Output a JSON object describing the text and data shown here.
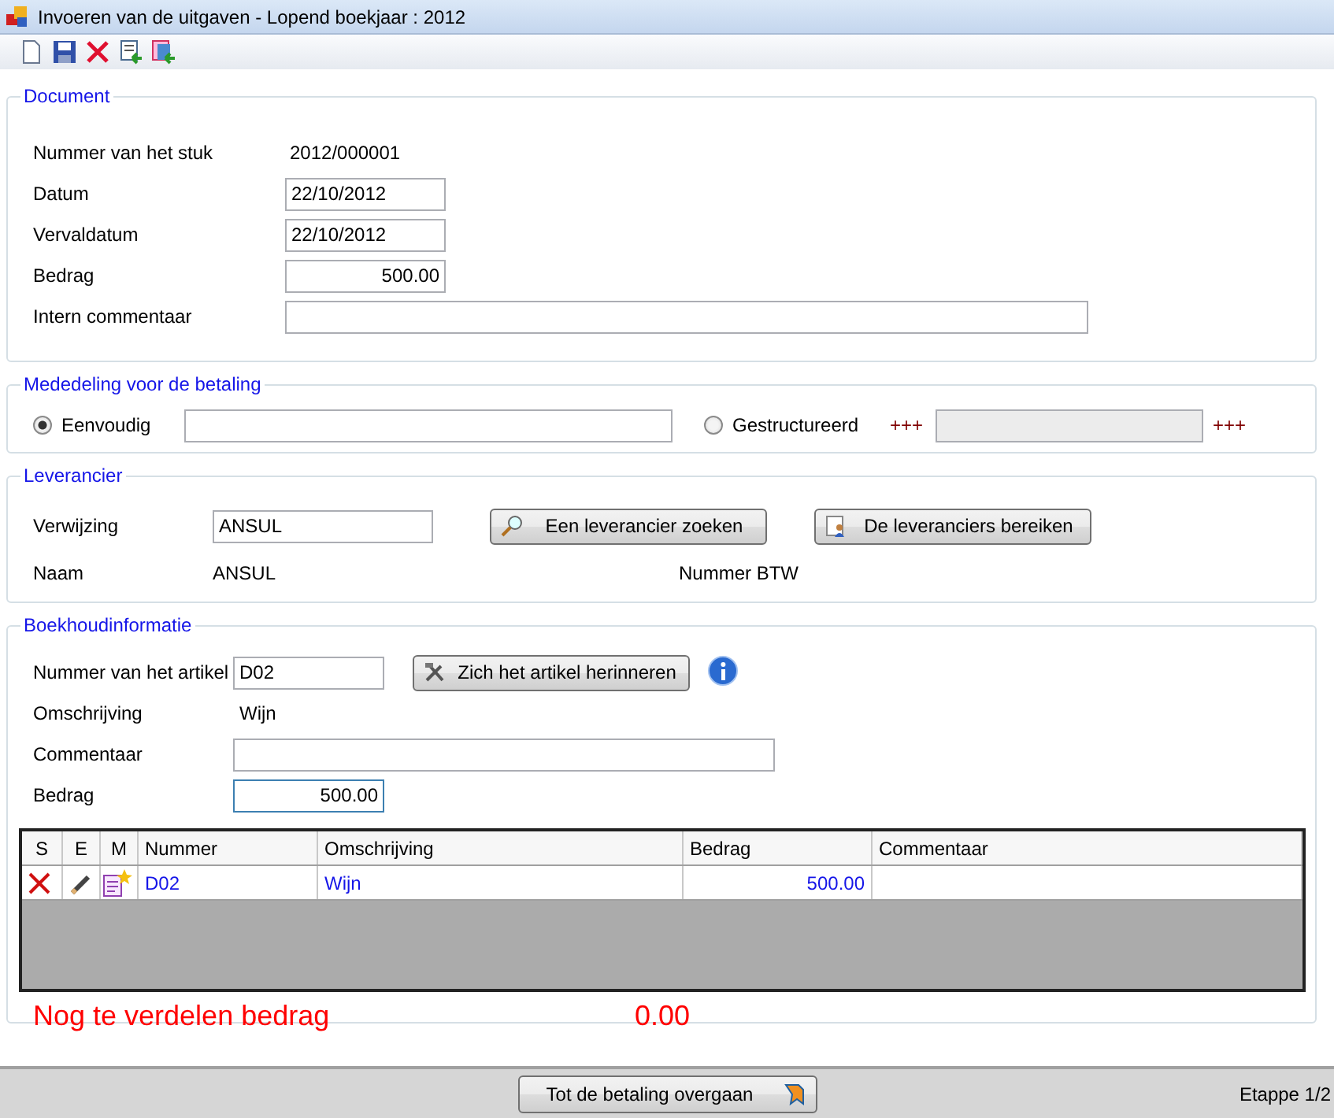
{
  "window": {
    "title": "Invoeren van de uitgaven - Lopend boekjaar : 2012"
  },
  "toolbar": [
    {
      "kind": "new"
    },
    {
      "kind": "save"
    },
    {
      "kind": "delete"
    },
    {
      "kind": "import"
    },
    {
      "kind": "export"
    }
  ],
  "document": {
    "title": "Document",
    "number_label": "Nummer van het stuk",
    "number": "2012/000001",
    "fields": [
      {
        "label": "Datum",
        "value": "22/10/2012",
        "kind": "short"
      },
      {
        "label": "Vervaldatum",
        "value": "22/10/2012",
        "kind": "short"
      },
      {
        "label": "Bedrag",
        "value": "500.00",
        "kind": "amount"
      },
      {
        "label": "Intern commentaar",
        "kind": "long"
      }
    ]
  },
  "payment": {
    "title": "Mededeling voor de betaling",
    "options": [
      {
        "label": "Eenvoudig",
        "selected": true
      },
      {
        "label": "Gestructureerd",
        "selected": false
      }
    ],
    "plus_left": "+++",
    "plus_right": "+++"
  },
  "supplier": {
    "title": "Leverancier",
    "ref_label": "Verwijzing",
    "ref": "ANSUL",
    "search_button": "Een leverancier zoeken",
    "reach_button": "De leveranciers bereiken",
    "name_label": "Naam",
    "name": "ANSUL",
    "vat_label": "Nummer BTW"
  },
  "accounting": {
    "title": "Boekhoudinformatie",
    "article_label": "Nummer van het artikel",
    "article": "D02",
    "recall_button": "Zich het artikel herinneren",
    "desc_label": "Omschrijving",
    "desc": "Wijn",
    "comment_label": "Commentaar",
    "amount_label": "Bedrag",
    "amount": "500.00",
    "columns": [
      "S",
      "E",
      "M",
      "Nummer",
      "Omschrijving",
      "Bedrag",
      "Commentaar"
    ],
    "rows": [
      {
        "nummer": "D02",
        "omschrijving": "Wijn",
        "bedrag": "500.00"
      }
    ],
    "remaining_label": "Nog te verdelen bedrag",
    "remaining": "0.00"
  },
  "footer": {
    "button": "Tot de betaling overgaan",
    "step": "Etappe 1/2"
  }
}
